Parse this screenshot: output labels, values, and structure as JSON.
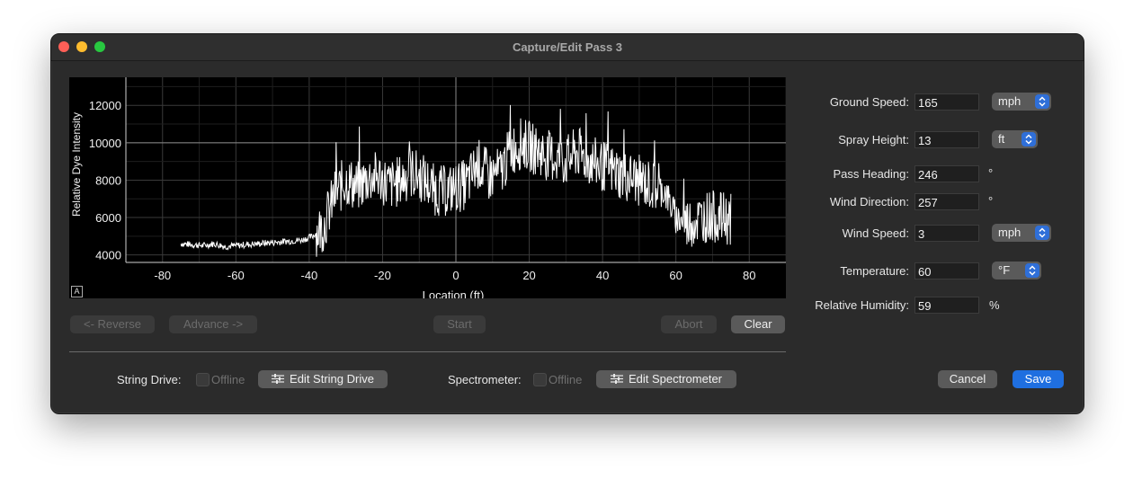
{
  "window": {
    "title": "Capture/Edit Pass 3"
  },
  "chart_data": {
    "type": "line",
    "xlabel": "Location (ft)",
    "ylabel": "Relative Dye Intensity",
    "xlim": [
      -90,
      90
    ],
    "ylim": [
      3600,
      13500
    ],
    "xticks": [
      -80,
      -60,
      -40,
      -20,
      0,
      20,
      40,
      60,
      80
    ],
    "yticks": [
      4000,
      6000,
      8000,
      10000,
      12000
    ],
    "x": [
      -75,
      -72,
      -69,
      -66,
      -63,
      -60,
      -57,
      -54,
      -51,
      -48,
      -45,
      -42,
      -39,
      -36,
      -33,
      -30,
      -27,
      -24,
      -21,
      -18,
      -15,
      -12,
      -9,
      -6,
      -3,
      0,
      3,
      6,
      9,
      12,
      15,
      18,
      21,
      24,
      27,
      30,
      33,
      36,
      39,
      42,
      45,
      48,
      51,
      54,
      57,
      60,
      63,
      66,
      69,
      72,
      75
    ],
    "series": [
      {
        "name": "",
        "values": [
          4600,
          4550,
          4500,
          4600,
          4450,
          4500,
          4550,
          4600,
          4650,
          4700,
          4750,
          4800,
          5000,
          5600,
          7200,
          8000,
          7600,
          8100,
          8200,
          7700,
          8000,
          8400,
          8100,
          7500,
          7400,
          7600,
          7800,
          8900,
          8200,
          8400,
          9600,
          10000,
          9700,
          9400,
          9200,
          9000,
          9500,
          9100,
          8800,
          8600,
          8300,
          8100,
          7900,
          7600,
          7400,
          6000,
          5700,
          5900,
          6100,
          6000,
          5900
        ]
      }
    ],
    "line_color": "#ffffff",
    "grid": true
  },
  "controls": {
    "reverse": "<- Reverse",
    "advance": "Advance ->",
    "start": "Start",
    "abort": "Abort",
    "clear": "Clear",
    "cancel": "Cancel",
    "save": "Save"
  },
  "devices": {
    "string_drive_label": "String Drive:",
    "string_drive_status": "Offline",
    "edit_string_drive": "Edit String Drive",
    "spectrometer_label": "Spectrometer:",
    "spectrometer_status": "Offline",
    "edit_spectrometer": "Edit Spectrometer"
  },
  "form": {
    "ground_speed": {
      "label": "Ground Speed:",
      "value": "165",
      "unit": "mph"
    },
    "spray_height": {
      "label": "Spray Height:",
      "value": "13",
      "unit": "ft"
    },
    "pass_heading": {
      "label": "Pass Heading:",
      "value": "246",
      "unit": "°"
    },
    "wind_direction": {
      "label": "Wind Direction:",
      "value": "257",
      "unit": "°"
    },
    "wind_speed": {
      "label": "Wind Speed:",
      "value": "3",
      "unit": "mph"
    },
    "temperature": {
      "label": "Temperature:",
      "value": "60",
      "unit": "°F"
    },
    "humidity": {
      "label": "Relative Humidity:",
      "value": "59",
      "unit": "%"
    }
  },
  "colors": {
    "primary": "#1f6fe0",
    "window_bg": "#2b2b2b",
    "chart_bg": "#000000"
  }
}
